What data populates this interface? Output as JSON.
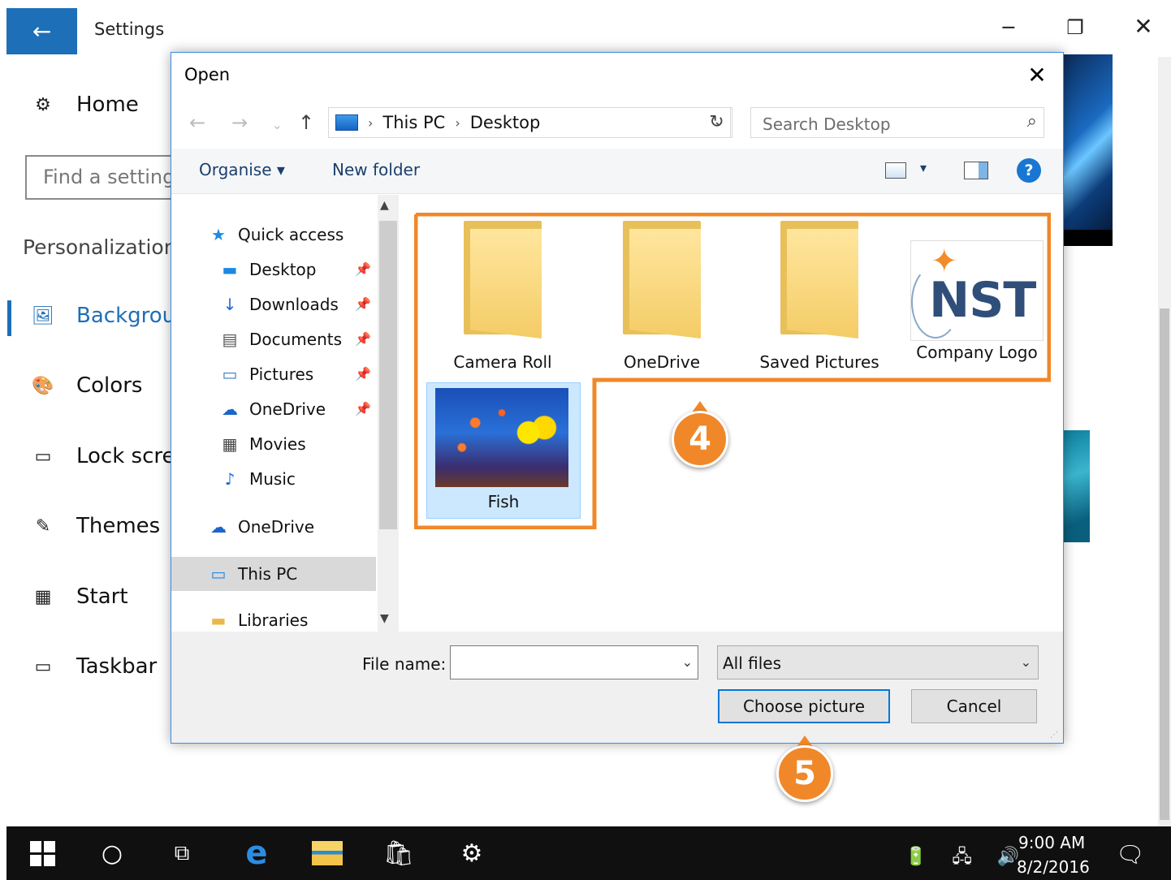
{
  "settings": {
    "title": "Settings",
    "back_icon": "←",
    "minimize_icon": "─",
    "maximize_icon": "❐",
    "close_icon": "✕",
    "home": {
      "label": "Home",
      "icon": "⚙"
    },
    "search_placeholder": "Find a setting",
    "section": "Personalization",
    "items": [
      {
        "label": "Background",
        "icon": "🖼"
      },
      {
        "label": "Colors",
        "icon": "🎨"
      },
      {
        "label": "Lock screen",
        "icon": "▭"
      },
      {
        "label": "Themes",
        "icon": "✎"
      },
      {
        "label": "Start",
        "icon": "▦"
      },
      {
        "label": "Taskbar",
        "icon": "▭"
      }
    ],
    "accent_color": "#1d6fb8"
  },
  "dialog": {
    "title": "Open",
    "close_icon": "✕",
    "nav": {
      "back": "←",
      "forward": "→",
      "recent": "⌄",
      "up": "↑"
    },
    "address": [
      "This PC",
      "Desktop"
    ],
    "address_sep": "›",
    "refresh_icon": "↻",
    "search_placeholder": "Search Desktop",
    "search_icon": "⌕",
    "toolbar": {
      "organise": "Organise ▾",
      "new_folder": "New folder",
      "view_drop": "▾",
      "help": "?"
    },
    "nav_pane": {
      "items": [
        {
          "label": "Quick access",
          "icon": "★",
          "icon_color": "#1e88e5"
        },
        {
          "label": "Desktop",
          "icon": "▬",
          "icon_color": "#1e88e5",
          "pinned": true
        },
        {
          "label": "Downloads",
          "icon": "↓",
          "icon_color": "#1e6ad6",
          "pinned": true
        },
        {
          "label": "Documents",
          "icon": "▤",
          "icon_color": "#555555",
          "pinned": true
        },
        {
          "label": "Pictures",
          "icon": "▭",
          "icon_color": "#3a7bc8",
          "pinned": true
        },
        {
          "label": "OneDrive",
          "icon": "☁",
          "icon_color": "#1a66c8",
          "pinned": true
        },
        {
          "label": "Movies",
          "icon": "▦",
          "icon_color": "#444444"
        },
        {
          "label": "Music",
          "icon": "♪",
          "icon_color": "#1e6ad6"
        },
        {
          "label": "OneDrive",
          "icon": "☁",
          "icon_color": "#1a66c8"
        },
        {
          "label": "This PC",
          "icon": "▭",
          "icon_color": "#1e88e5"
        },
        {
          "label": "Libraries",
          "icon": "▬",
          "icon_color": "#e8b84a"
        }
      ],
      "pin_icon": "📌",
      "scroll_up": "▲",
      "scroll_down": "▼"
    },
    "files": [
      {
        "label": "Camera Roll",
        "kind": "folder"
      },
      {
        "label": "OneDrive",
        "kind": "folder"
      },
      {
        "label": "Saved Pictures",
        "kind": "folder"
      },
      {
        "label": "Company Logo",
        "kind": "image",
        "logo_text": "NST"
      },
      {
        "label": "Fish",
        "kind": "image",
        "selected": true
      }
    ],
    "file_name_label": "File name:",
    "file_name_value": "",
    "filter_value": "All files",
    "dropdown_icon": "⌄",
    "choose_button": "Choose picture",
    "cancel_button": "Cancel"
  },
  "callouts": {
    "step4": "4",
    "step5": "5",
    "color": "#f0882a"
  },
  "taskbar": {
    "search_icon": "○",
    "task_view_icon": "⧉",
    "edge_icon": "e",
    "store_icon": "🛍",
    "settings_icon": "⚙",
    "tray": "🔋 🖧 🔊",
    "time": "9:00 AM",
    "date": "8/2/2016",
    "notifications_icon": "🗨"
  }
}
